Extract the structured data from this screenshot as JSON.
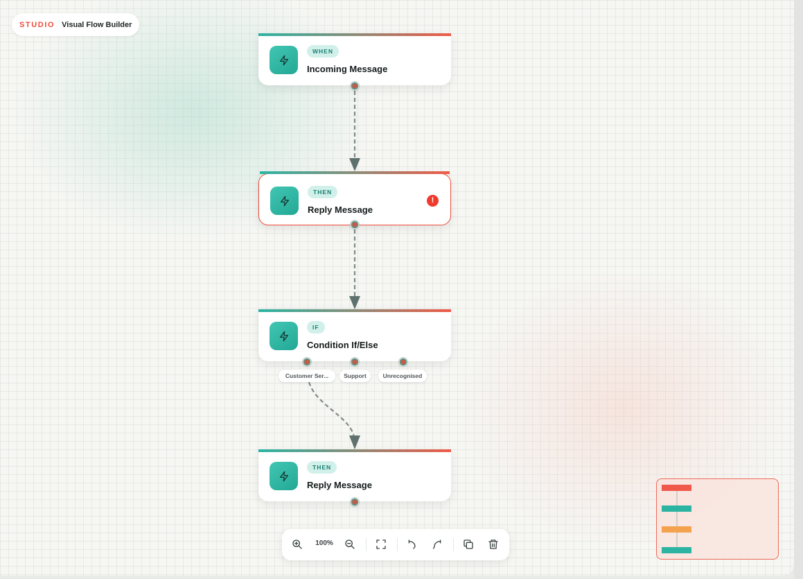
{
  "brand": {
    "label": "STUDIO",
    "title": "Visual Flow Builder"
  },
  "nodes": [
    {
      "badge": "WHEN",
      "title": "Incoming Message"
    },
    {
      "badge": "THEN",
      "title": "Reply Message",
      "error_icon": "!"
    },
    {
      "badge": "IF",
      "title": "Condition If/Else"
    },
    {
      "badge": "THEN",
      "title": "Reply Message"
    }
  ],
  "branches": [
    "Customer Ser...",
    "Support",
    "Unrecognised"
  ],
  "toolbar": {
    "zoom": "100%"
  },
  "icons": {
    "node": "lightning-bolt-icon",
    "error": "alert-circle-icon",
    "zoom_in": "zoom-in-icon",
    "zoom_out": "zoom-out-icon",
    "fit": "fit-screen-icon",
    "undo": "undo-icon",
    "redo": "redo-icon",
    "duplicate": "copy-icon",
    "delete": "trash-icon"
  },
  "colors": {
    "accent_teal": "#2cb4a3",
    "accent_red": "#ef4a3a",
    "minimap_orange": "#f4a24e",
    "connector": "#5e716e"
  },
  "minimap_bars": [
    "red",
    "teal",
    "orange",
    "teal"
  ]
}
